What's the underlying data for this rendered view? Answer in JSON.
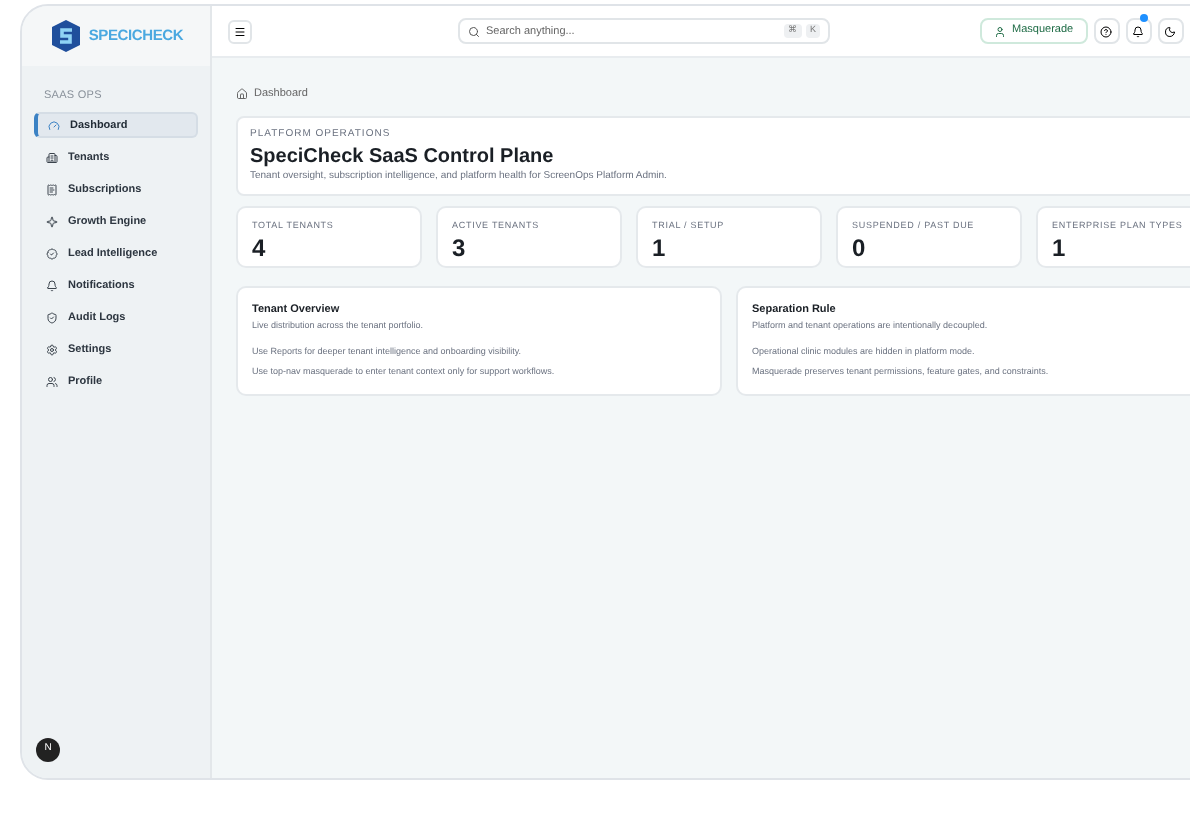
{
  "logo": {
    "name": "SPECICHECK"
  },
  "sidebar": {
    "section": "SAAS OPS",
    "items": [
      {
        "label": "Dashboard",
        "selected": true
      },
      {
        "label": "Tenants",
        "selected": false
      },
      {
        "label": "Subscriptions",
        "selected": false
      },
      {
        "label": "Growth Engine",
        "selected": false
      },
      {
        "label": "Lead Intelligence",
        "selected": false
      },
      {
        "label": "Notifications",
        "selected": false
      },
      {
        "label": "Audit Logs",
        "selected": false
      },
      {
        "label": "Settings",
        "selected": false
      },
      {
        "label": "Profile",
        "selected": false
      }
    ],
    "dev_badge": "N"
  },
  "topbar": {
    "search": {
      "placeholder": "Search anything...",
      "shortcut": [
        "⌘",
        "K"
      ]
    },
    "masquerade": "Masquerade"
  },
  "breadcrumb": "Dashboard",
  "header": {
    "eyebrow": "PLATFORM OPERATIONS",
    "title": "SpeciCheck SaaS Control Plane",
    "subtitle": "Tenant oversight, subscription intelligence, and platform health for ScreenOps Platform Admin."
  },
  "stats": [
    {
      "label": "TOTAL TENANTS",
      "value": "4"
    },
    {
      "label": "ACTIVE TENANTS",
      "value": "3"
    },
    {
      "label": "TRIAL / SETUP",
      "value": "1"
    },
    {
      "label": "SUSPENDED / PAST DUE",
      "value": "0"
    },
    {
      "label": "ENTERPRISE PLAN TYPES",
      "value": "1"
    }
  ],
  "panels": [
    {
      "title": "Tenant Overview",
      "subtitle": "Live distribution across the tenant portfolio.",
      "lines": [
        "Use Reports for deeper tenant intelligence and onboarding visibility.",
        "Use top-nav masquerade to enter tenant context only for support workflows."
      ]
    },
    {
      "title": "Separation Rule",
      "subtitle": "Platform and tenant operations are intentionally decoupled.",
      "lines": [
        "Operational clinic modules are hidden in platform mode.",
        "Masquerade preserves tenant permissions, feature gates, and constraints."
      ]
    }
  ]
}
